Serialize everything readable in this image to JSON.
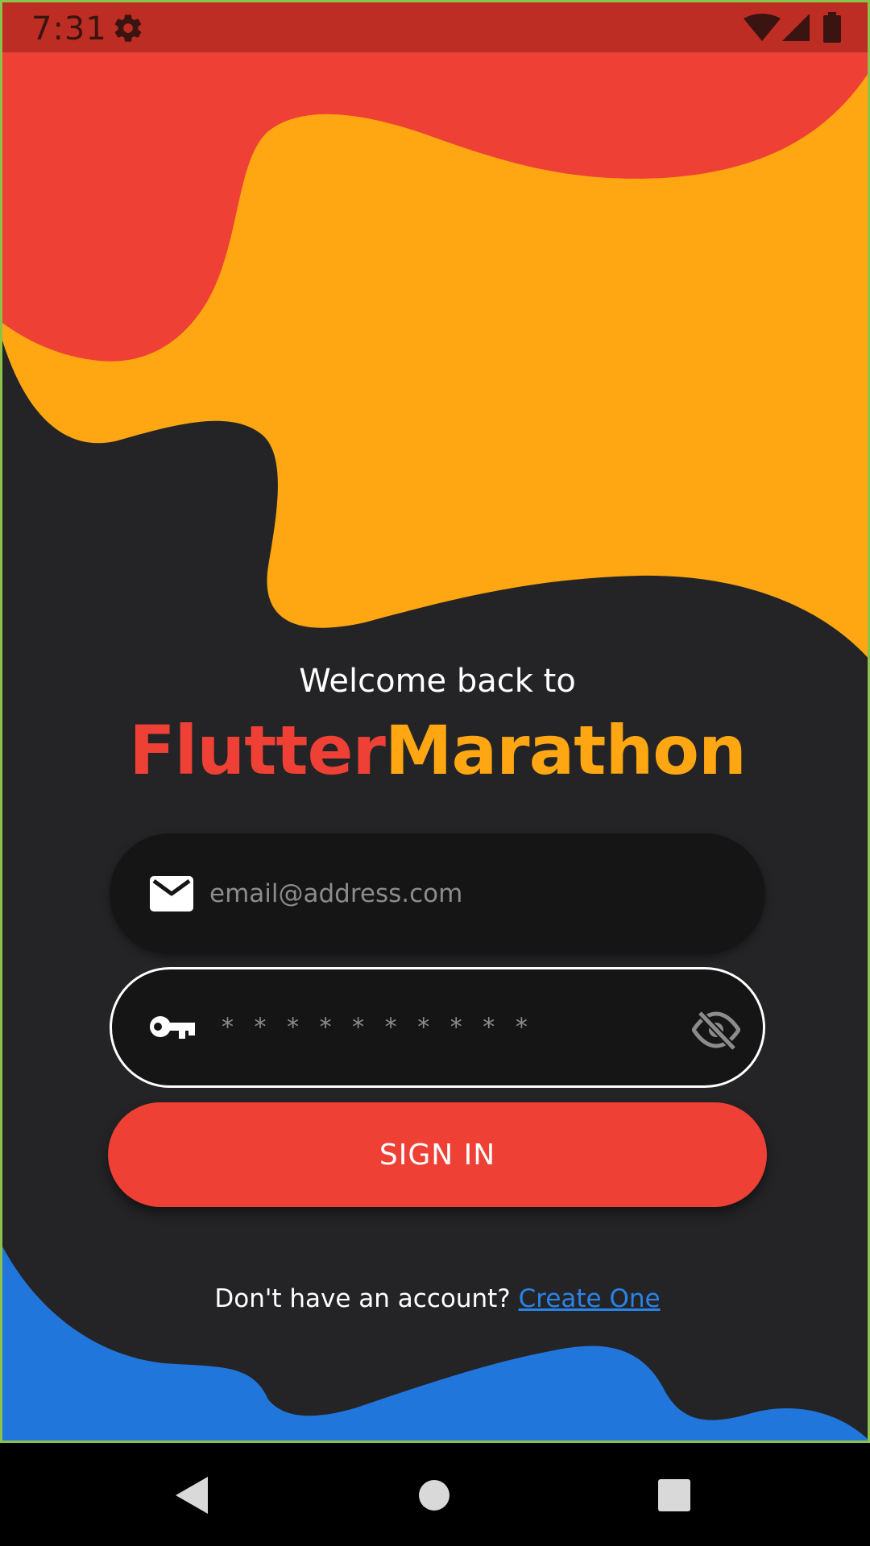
{
  "status_bar": {
    "time": "7:31",
    "icons": [
      "gear-icon",
      "wifi-icon",
      "signal-icon",
      "battery-icon"
    ]
  },
  "welcome": {
    "line1": "Welcome back to",
    "brand_part1": "Flutter",
    "brand_part2": "Marathon"
  },
  "form": {
    "email_placeholder": "email@address.com",
    "password_mask": "* * * * * * * * * *",
    "signin_label": "SIGN IN"
  },
  "signup": {
    "prompt": "Don't have an account?",
    "link": "Create One"
  },
  "colors": {
    "background": "#242427",
    "red": "#ee4035",
    "orange": "#ffa712",
    "blue": "#2176dc",
    "link": "#2a83e6"
  },
  "nav_bar": {
    "icons": [
      "back-icon",
      "home-icon",
      "recents-icon"
    ]
  }
}
